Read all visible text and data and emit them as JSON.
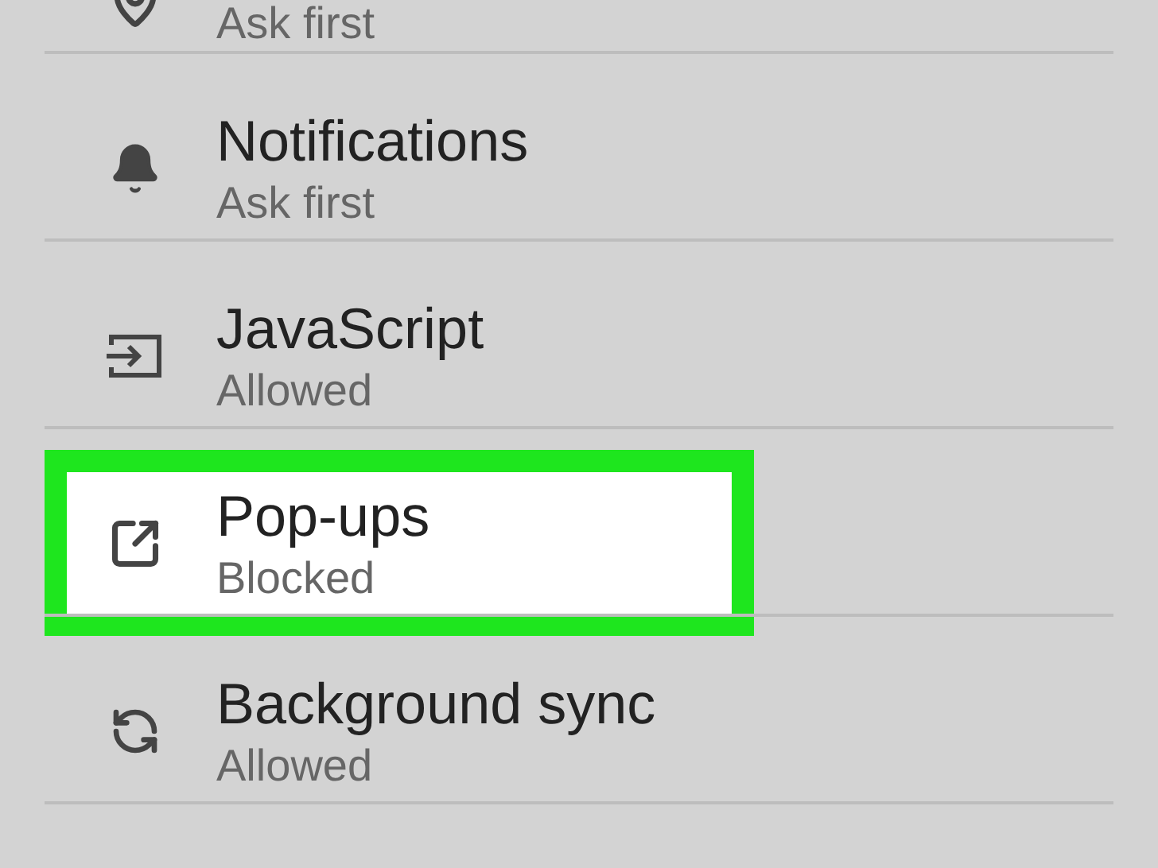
{
  "settings": [
    {
      "kind": "location",
      "subtitle": "Ask first",
      "highlighted": false
    },
    {
      "kind": "notifications",
      "title": "Notifications",
      "subtitle": "Ask first",
      "highlighted": false
    },
    {
      "kind": "javascript",
      "title": "JavaScript",
      "subtitle": "Allowed",
      "highlighted": false
    },
    {
      "kind": "popups",
      "title": "Pop-ups",
      "subtitle": "Blocked",
      "highlighted": true
    },
    {
      "kind": "sync",
      "title": "Background sync",
      "subtitle": "Allowed",
      "highlighted": false
    }
  ]
}
